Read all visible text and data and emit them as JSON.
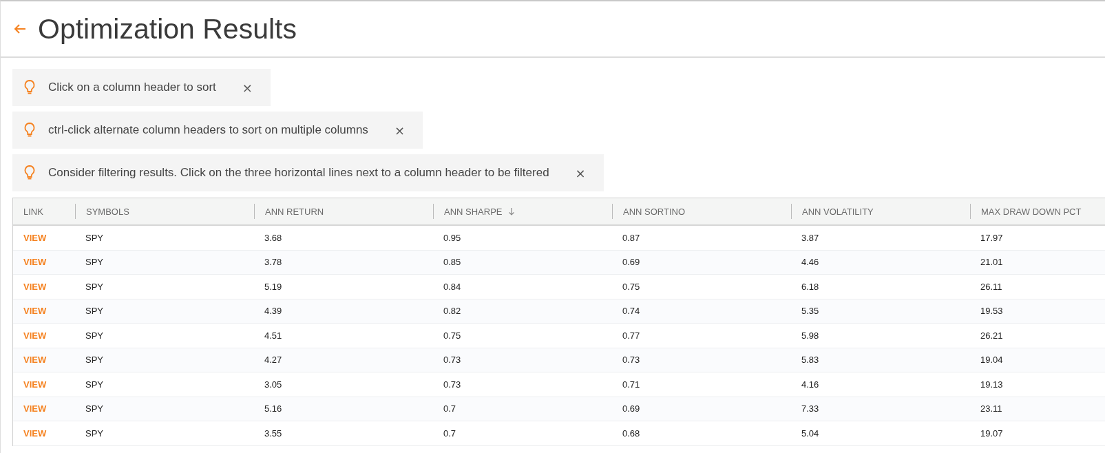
{
  "header": {
    "title": "Optimization Results"
  },
  "tips": [
    {
      "text": "Click on a column header to sort",
      "close": "×"
    },
    {
      "text": "ctrl-click alternate column headers to sort on multiple columns",
      "close": "×"
    },
    {
      "text": "Consider filtering results. Click on the three horizontal lines next to a column header to be filtered",
      "close": "×"
    }
  ],
  "table": {
    "columns": [
      {
        "label": "LINK",
        "sorted": false
      },
      {
        "label": "SYMBOLS",
        "sorted": false
      },
      {
        "label": "ANN RETURN",
        "sorted": false
      },
      {
        "label": "ANN SHARPE",
        "sorted": true
      },
      {
        "label": "ANN SORTINO",
        "sorted": false
      },
      {
        "label": "ANN VOLATILITY",
        "sorted": false
      },
      {
        "label": "MAX DRAW DOWN PCT",
        "sorted": false
      }
    ],
    "rows": [
      [
        "VIEW",
        "SPY",
        "3.68",
        "0.95",
        "0.87",
        "3.87",
        "17.97"
      ],
      [
        "VIEW",
        "SPY",
        "3.78",
        "0.85",
        "0.69",
        "4.46",
        "21.01"
      ],
      [
        "VIEW",
        "SPY",
        "5.19",
        "0.84",
        "0.75",
        "6.18",
        "26.11"
      ],
      [
        "VIEW",
        "SPY",
        "4.39",
        "0.82",
        "0.74",
        "5.35",
        "19.53"
      ],
      [
        "VIEW",
        "SPY",
        "4.51",
        "0.75",
        "0.77",
        "5.98",
        "26.21"
      ],
      [
        "VIEW",
        "SPY",
        "4.27",
        "0.73",
        "0.73",
        "5.83",
        "19.04"
      ],
      [
        "VIEW",
        "SPY",
        "3.05",
        "0.73",
        "0.71",
        "4.16",
        "19.13"
      ],
      [
        "VIEW",
        "SPY",
        "5.16",
        "0.7",
        "0.69",
        "7.33",
        "23.11"
      ],
      [
        "VIEW",
        "SPY",
        "3.55",
        "0.7",
        "0.68",
        "5.04",
        "19.07"
      ]
    ]
  }
}
